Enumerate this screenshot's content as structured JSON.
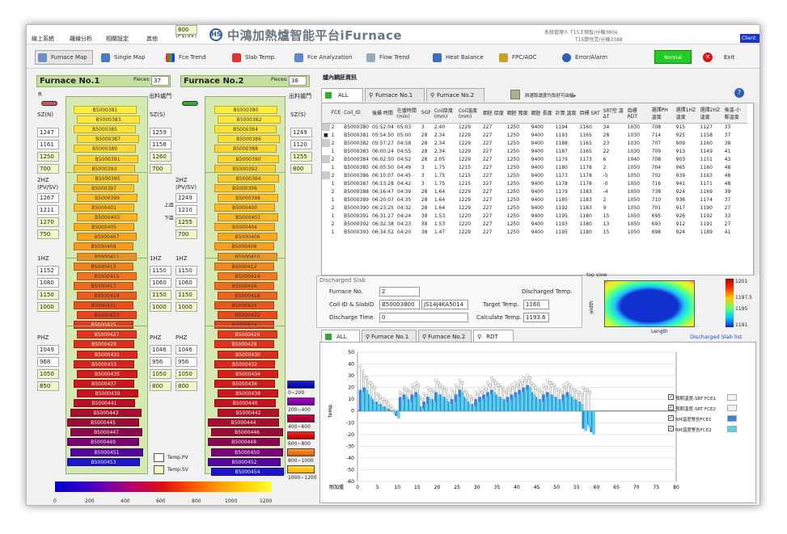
{
  "menu": {
    "items": [
      "線上系統",
      "離線分析",
      "相關設定",
      "其他"
    ]
  },
  "app": {
    "logo": "HS",
    "title": "中鴻加熱爐智能平台iFurnace",
    "admin_line1": "系統管理人  T15王郁智/分機3804",
    "admin_line2": "T15鄭恆昱/分機3388",
    "client": "Client"
  },
  "toolbar": {
    "buttons": [
      "Furnace Map",
      "Single Map",
      "Fce Trend",
      "Slab Temp.",
      "Fce Analyzation",
      "Flow Trend",
      "Heat Balance",
      "FPC/AOC",
      "Error/Alarm"
    ],
    "normal": "Normal",
    "exit": "Exit"
  },
  "f1": {
    "title": "Furnace No.1",
    "pieces_label": "Pieces:",
    "pieces": "37",
    "arrow": "R",
    "outlet": "出料爐門",
    "zones": [
      {
        "label": "SZ(N)",
        "vals": [
          "1247",
          "1161",
          "1250",
          "700"
        ]
      },
      {
        "label": "2HZ (PV/SV)",
        "vals": [
          "1267",
          "1211",
          "1270",
          "750"
        ]
      },
      {
        "label": "1HZ",
        "vals": [
          "1152",
          "1080",
          "1150",
          "1000"
        ]
      },
      {
        "label": "PHZ",
        "vals": [
          "1049",
          "968",
          "1050",
          "850"
        ]
      }
    ],
    "zones2": [
      {
        "label": "SZ(S)",
        "vals": [
          "1259",
          "1158",
          "1260",
          "700"
        ]
      },
      {
        "label": "2HZ (PV/SV)",
        "vals": [
          "",
          "",
          "",
          ""
        ]
      },
      {
        "label": "1HZ",
        "vals": [
          "1150",
          "1060",
          "1150",
          "1000"
        ]
      },
      {
        "label": "PHZ",
        "vals": [
          "1046",
          "956",
          "1050",
          "800"
        ]
      }
    ],
    "slabs": [
      "B5000381",
      "B5000383",
      "B5000385",
      "B5000387",
      "B5000389",
      "B5000391",
      "B5000393",
      "B5000395",
      "B5000397",
      "B5000399",
      "B5000401",
      "B5000403",
      "B5000405",
      "B5000407",
      "B5000409",
      "B5000411",
      "B5000413",
      "B5000415",
      "B5000417",
      "B5000419",
      "B5000421",
      "B5000423",
      "B5000425",
      "B5000427",
      "B5000429",
      "B5000431",
      "B5000433",
      "B5000435",
      "B5000437",
      "B5000439",
      "B5000441",
      "B5000443",
      "B5000445",
      "B5000447",
      "B5000449",
      "B5000451",
      "B5000453"
    ]
  },
  "f2": {
    "title": "Furnace No.2",
    "pieces_label": "Pieces:",
    "pieces": "38",
    "outlet": "出料爐門",
    "upper": "上區",
    "lower": "下區",
    "zones": [
      {
        "label": "SZ(S)",
        "vals": [
          "1245",
          "1158",
          "1245",
          "800"
        ]
      },
      {
        "label": "2HZ (PV/SV)",
        "vals": [
          "1249",
          "1210",
          "1255",
          "700"
        ]
      },
      {
        "label": "1HZ",
        "vals": [
          "1150",
          "1060",
          "1150",
          "1000"
        ]
      },
      {
        "label": "PHZ",
        "vals": [
          "1046",
          "956",
          "1050",
          "800"
        ]
      }
    ],
    "zones_r": [
      {
        "label": "SZ(S)",
        "vals": [
          "1249",
          "1120",
          "1255",
          "800"
        ]
      }
    ],
    "slabs": [
      "B5000380",
      "B5000382",
      "B5000384",
      "B5000386",
      "B5000388",
      "B5000390",
      "B5000392",
      "B5000394",
      "B5000396",
      "B5000398",
      "B5000400",
      "B5000402",
      "B5000404",
      "B5000406",
      "B5000408",
      "B5000410",
      "B5000412",
      "B5000414",
      "B5000416",
      "B5000418",
      "B5000420",
      "B5000422",
      "B5000424",
      "B5000426",
      "B5000428",
      "B5000430",
      "B5000432",
      "B5000434",
      "B5000436",
      "B5000438",
      "B5000440",
      "B5000442",
      "B5000444",
      "B5000446",
      "B5000448",
      "B5000450",
      "B5000452",
      "B5000454"
    ]
  },
  "legend": {
    "pv": "Temp.PV",
    "sv": "Temp.SV",
    "ranges": [
      "0~200",
      "200~400",
      "400~600",
      "600~800",
      "800~1000",
      "1000~1200"
    ],
    "ticks": [
      "0",
      "200",
      "400",
      "600",
      "800",
      "1000",
      "1200"
    ]
  },
  "right": {
    "title": "爐內鋼胚資訊",
    "tabs": [
      "ALL",
      "Furnace No.1",
      "Furnace No.2"
    ],
    "option": "將選取運度均負好可由幅▸",
    "headers": [
      "FCE",
      "Coil_ID",
      "後續 時間",
      "在爐時間 (min)",
      "SGF",
      "Coil厚度 (mm)",
      "Coil溫度 (mm)",
      "鋼胚 厚度",
      "鋼胚 寬度",
      "鋼胚 長度",
      "計算 溫度",
      "目標 SRT",
      "SRT控 溫ΔT",
      "目標 RDT",
      "選擇PH 溫度",
      "選擇1HZ 溫度",
      "選擇2HZ 溫度",
      "後溫-小 鄰溫度"
    ],
    "rows": [
      [
        "2",
        "B5000380",
        "05:52:04",
        "05:03",
        "3",
        "2.40",
        "1229",
        "227",
        "1250",
        "9400",
        "1194",
        "1160",
        "34",
        "1030",
        "708",
        "915",
        "1127",
        "33"
      ],
      [
        "1",
        "B5000381",
        "05:54:50",
        "05:00",
        "28",
        "2.34",
        "1229",
        "227",
        "1250",
        "9400",
        "1193",
        "1165",
        "28",
        "1030",
        "714",
        "925",
        "1158",
        "37"
      ],
      [
        "2",
        "B5000382",
        "05:57:27",
        "04:58",
        "28",
        "2.34",
        "1229",
        "227",
        "1250",
        "9400",
        "1188",
        "1165",
        "23",
        "1030",
        "707",
        "909",
        "1160",
        "38"
      ],
      [
        "1",
        "B5000383",
        "06:00:24",
        "04:55",
        "28",
        "2.34",
        "1229",
        "227",
        "1250",
        "9400",
        "1187",
        "1165",
        "22",
        "1030",
        "709",
        "913",
        "1149",
        "41"
      ],
      [
        "2",
        "B5000384",
        "06:02:50",
        "04:52",
        "28",
        "2.05",
        "1229",
        "227",
        "1250",
        "9400",
        "1179",
        "1173",
        "6",
        "1040",
        "708",
        "903",
        "1151",
        "43"
      ],
      [
        "1",
        "B5000385",
        "06:05:50",
        "04:49",
        "3",
        "1.75",
        "1215",
        "227",
        "1250",
        "9400",
        "1180",
        "1178",
        "2",
        "1050",
        "704",
        "965",
        "1160",
        "48"
      ],
      [
        "2",
        "B5000386",
        "06:10:07",
        "04:45",
        "3",
        "1.75",
        "1215",
        "227",
        "1250",
        "9400",
        "1173",
        "1178",
        "-5",
        "1050",
        "702",
        "939",
        "1163",
        "48"
      ],
      [
        "1",
        "B5000387",
        "06:13:28",
        "04:42",
        "3",
        "1.75",
        "1215",
        "227",
        "1250",
        "9400",
        "1178",
        "1178",
        "-0",
        "1050",
        "716",
        "941",
        "1171",
        "48"
      ],
      [
        "2",
        "B5000388",
        "06:16:47",
        "04:39",
        "28",
        "1.64",
        "1229",
        "227",
        "1250",
        "9400",
        "1179",
        "1183",
        "-4",
        "1050",
        "738",
        "924",
        "1169",
        "39"
      ],
      [
        "1",
        "B5000389",
        "06:20:07",
        "04:35",
        "28",
        "1.64",
        "1229",
        "227",
        "1250",
        "9400",
        "1185",
        "1183",
        "2",
        "1050",
        "710",
        "936",
        "1174",
        "37"
      ],
      [
        "2",
        "B5000390",
        "06:23:25",
        "04:32",
        "28",
        "1.64",
        "1229",
        "227",
        "1250",
        "9400",
        "1192",
        "1183",
        "9",
        "1050",
        "701",
        "917",
        "1190",
        "27"
      ],
      [
        "1",
        "B5000391",
        "06:31:27",
        "04:24",
        "38",
        "1.53",
        "1220",
        "227",
        "1250",
        "9400",
        "1195",
        "1180",
        "15",
        "1050",
        "695",
        "926",
        "1192",
        "33"
      ],
      [
        "2",
        "B5000392",
        "06:32:38",
        "04:23",
        "38",
        "1.53",
        "1220",
        "227",
        "1250",
        "9400",
        "1193",
        "1180",
        "13",
        "1050",
        "693",
        "912",
        "1191",
        "27"
      ],
      [
        "1",
        "B5000393",
        "06:34:52",
        "04:20",
        "38",
        "1.47",
        "1229",
        "227",
        "1250",
        "9400",
        "1195",
        "1180",
        "15",
        "1050",
        "698",
        "924",
        "1189",
        "41"
      ]
    ]
  },
  "discharged": {
    "title": "Discharged Slab",
    "fno_label": "Furnace No.",
    "fno": "2",
    "coil_label": "Coil ID & SlabID",
    "slab_id": "B50003800",
    "coil_id": "JS14J4KA5014",
    "time_label": "Discharge Time",
    "time": "0",
    "dtemp_label": "Discharged Temp.",
    "target_label": "Target Temp.",
    "target": "1160",
    "calc_label": "Calculate Temp.",
    "calc": "1193.6"
  },
  "topview": {
    "title": "top view",
    "ylabel": "width",
    "xlabel": "Length",
    "scale": [
      "1201",
      "1197.5",
      "1195",
      "1191"
    ],
    "list_link": "Discharged Slab list"
  },
  "chart_tabs": [
    "ALL",
    "Furnace No.1",
    "Furnace No.2",
    "RDT"
  ],
  "chart_data": {
    "type": "bar",
    "xlabel": "剛加爐",
    "ylabel": "temp",
    "ylim": [
      -60,
      50
    ],
    "xlim": [
      0,
      80
    ],
    "yticks": [
      "50",
      "40",
      "30",
      "20",
      "10",
      "0",
      "-10",
      "-20",
      "-30",
      "-40",
      "-50",
      "-60"
    ],
    "xticks": [
      "0",
      "5",
      "10",
      "15",
      "20",
      "25",
      "30",
      "35",
      "40",
      "45",
      "50",
      "55",
      "60",
      "65",
      "70",
      "75",
      "80"
    ],
    "series": [
      {
        "name": "預期溫度-SRT FCE1",
        "type": "stem",
        "values": [
          38,
          30,
          25,
          22,
          15,
          12,
          10,
          6,
          2,
          -3,
          16,
          20,
          18,
          22,
          24,
          12,
          15,
          20,
          18,
          26,
          22,
          20,
          14,
          18,
          22,
          26,
          18,
          14,
          12,
          16,
          18,
          20,
          24,
          28,
          24,
          22,
          18,
          20,
          22,
          24,
          26,
          28,
          30,
          24,
          20,
          18,
          22,
          26,
          24,
          20,
          18,
          22,
          24,
          20,
          18,
          16,
          20,
          18,
          -5
        ]
      },
      {
        "name": "預期溫度-SRT FCE2",
        "type": "stem",
        "values": [
          34,
          28,
          24,
          20,
          14,
          10,
          8,
          4,
          0,
          -5,
          14,
          18,
          16,
          20,
          22,
          10,
          13,
          18,
          16,
          24,
          20,
          18,
          12,
          16,
          20,
          24,
          16,
          12,
          10,
          14,
          16,
          18,
          22,
          26,
          22,
          20,
          16,
          18,
          20,
          22,
          24,
          26,
          28,
          22,
          18,
          16,
          20,
          24,
          22,
          18,
          16,
          20,
          22,
          18,
          16,
          14,
          18,
          16,
          -7
        ]
      },
      {
        "name": "RM溫度警告FCE1",
        "type": "bar",
        "values": [
          18,
          20,
          14,
          10,
          8,
          6,
          4,
          2,
          0,
          -4,
          12,
          14,
          10,
          14,
          16,
          4,
          8,
          12,
          10,
          16,
          14,
          12,
          8,
          10,
          14,
          18,
          12,
          8,
          6,
          10,
          12,
          14,
          16,
          18,
          14,
          12,
          10,
          12,
          14,
          16,
          18,
          20,
          22,
          16,
          12,
          10,
          14,
          16,
          14,
          12,
          10,
          14,
          16,
          12,
          10,
          8,
          -15,
          -12,
          -18
        ]
      },
      {
        "name": "RM溫度警告FCE2",
        "type": "bar",
        "values": [
          16,
          18,
          12,
          8,
          6,
          4,
          2,
          0,
          -2,
          -6,
          10,
          12,
          8,
          12,
          14,
          2,
          6,
          10,
          8,
          14,
          12,
          10,
          6,
          8,
          12,
          16,
          10,
          6,
          4,
          8,
          10,
          12,
          14,
          16,
          12,
          10,
          8,
          10,
          12,
          14,
          16,
          18,
          20,
          14,
          10,
          8,
          12,
          14,
          12,
          10,
          8,
          12,
          14,
          10,
          8,
          6,
          -17,
          -14,
          -20
        ]
      }
    ]
  }
}
